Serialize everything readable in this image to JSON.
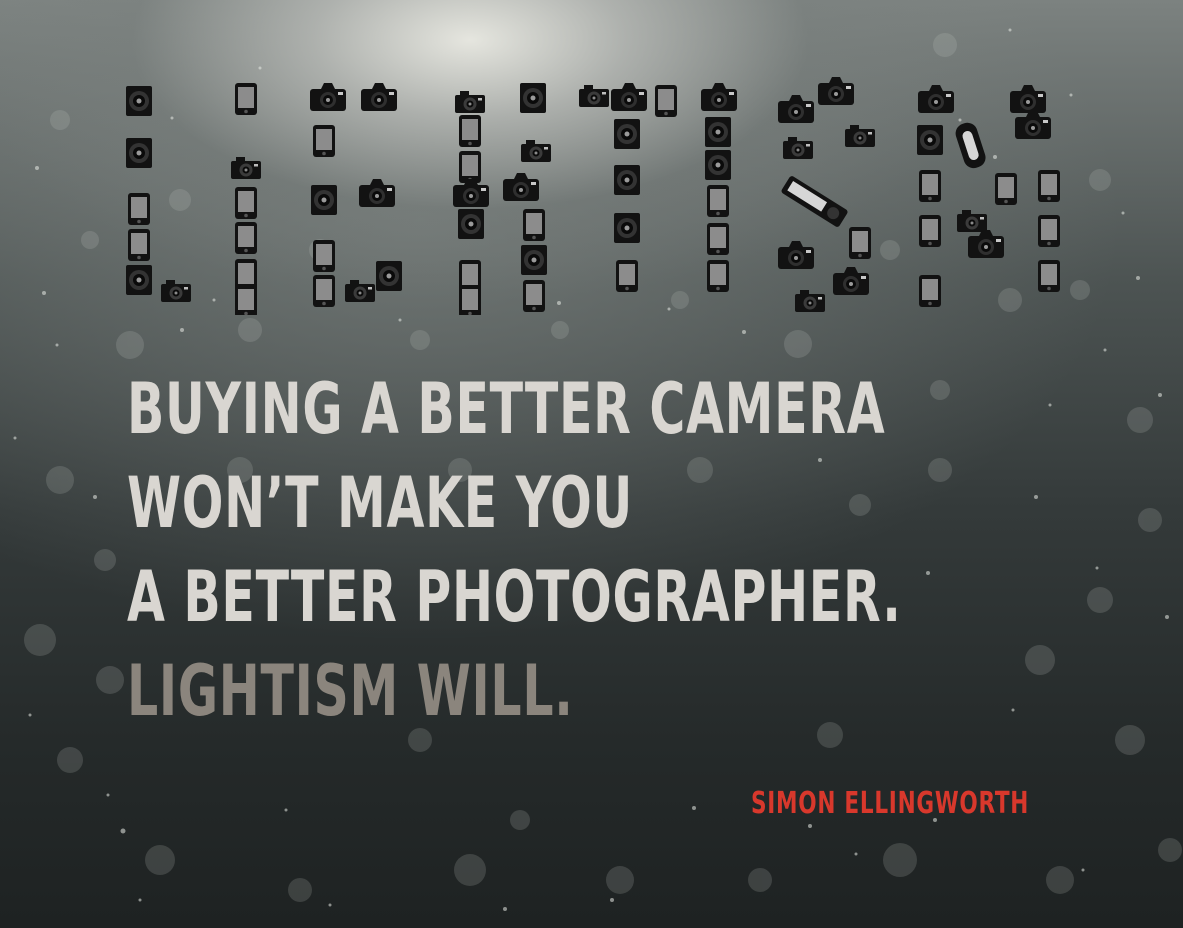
{
  "logo": {
    "title": "LIGHTISM",
    "letters": [
      "L",
      "I",
      "G",
      "H",
      "T",
      "I",
      "S",
      "M"
    ]
  },
  "quote": {
    "line1": "BUYING A BETTER CAMERA",
    "line2": "WON’T MAKE YOU",
    "line3": "A BETTER PHOTOGRAPHER.",
    "line4": "LIGHTISM WILL."
  },
  "author": "SIMON ELLINGWORTH",
  "colors": {
    "quote_text": "#d9d6d1",
    "quote_dim": "#8b857d",
    "author": "#d8382c",
    "camera_icons": "#121212"
  },
  "icons": [
    "camera-icon",
    "bokeh-background"
  ]
}
